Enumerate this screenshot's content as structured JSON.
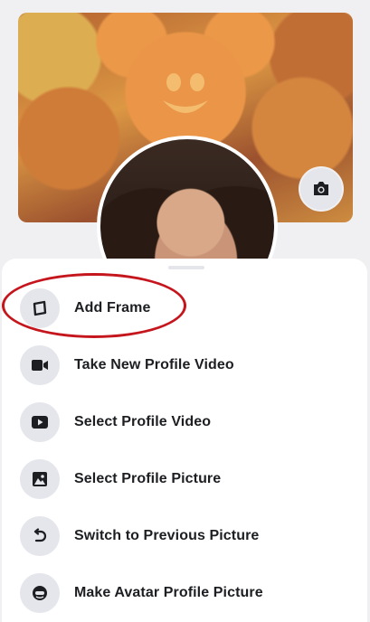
{
  "profile": {
    "cover_photo_alt": "",
    "camera_icon": "camera-icon"
  },
  "menu": {
    "items": [
      {
        "label": "Add Frame",
        "icon": "frame-icon"
      },
      {
        "label": "Take New Profile Video",
        "icon": "video-camera-icon"
      },
      {
        "label": "Select Profile Video",
        "icon": "play-icon"
      },
      {
        "label": "Select Profile Picture",
        "icon": "photo-icon"
      },
      {
        "label": "Switch to Previous Picture",
        "icon": "undo-icon"
      },
      {
        "label": "Make Avatar Profile Picture",
        "icon": "avatar-icon"
      }
    ]
  },
  "colors": {
    "highlight": "#c5161d",
    "icon_bg": "#e4e6eb",
    "text": "#1c1e21"
  }
}
